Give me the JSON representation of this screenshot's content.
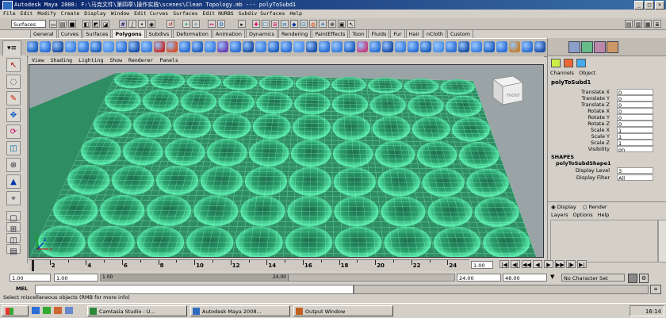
{
  "window": {
    "title": "Autodesk Maya 2008: F:\\马克文件\\第四章\\操作实践\\scenes\\Clean Topology.mb   ---   polyToSubd1"
  },
  "menu": [
    "File",
    "Edit",
    "Modify",
    "Create",
    "Display",
    "Window",
    "Edit Curves",
    "Surfaces",
    "Edit NURBS",
    "Subdiv Surfaces",
    "Help"
  ],
  "status_line": {
    "mode": "Surfaces"
  },
  "shelf_tabs": [
    "General",
    "Curves",
    "Surfaces",
    "Polygons",
    "Subdivs",
    "Deformation",
    "Animation",
    "Dynamics",
    "Rendering",
    "PaintEffects",
    "Toon",
    "Fluids",
    "Fur",
    "Hair",
    "nCloth",
    "Custom"
  ],
  "active_shelf_tab": "Polygons",
  "panel_menu": [
    "View",
    "Shading",
    "Lighting",
    "Show",
    "Renderer",
    "Panels"
  ],
  "viewcube_label": "FRONT",
  "channel_box": {
    "header": [
      "Channels",
      "Object"
    ],
    "object_name": "polyToSubd1",
    "attributes": [
      {
        "label": "Translate X",
        "value": "0"
      },
      {
        "label": "Translate Y",
        "value": "0"
      },
      {
        "label": "Translate Z",
        "value": "0"
      },
      {
        "label": "Rotate X",
        "value": "0"
      },
      {
        "label": "Rotate Y",
        "value": "0"
      },
      {
        "label": "Rotate Z",
        "value": "0"
      },
      {
        "label": "Scale X",
        "value": "1"
      },
      {
        "label": "Scale Y",
        "value": "1"
      },
      {
        "label": "Scale Z",
        "value": "1"
      },
      {
        "label": "Visibility",
        "value": "on"
      }
    ],
    "shapes_label": "SHAPES",
    "shape_name": "polyToSubdShape1",
    "shape_attributes": [
      {
        "label": "Display Level",
        "value": "3"
      },
      {
        "label": "Display Filter",
        "value": "All"
      }
    ]
  },
  "layer_editor": {
    "display_label": "Display",
    "render_label": "Render",
    "menu": [
      "Layers",
      "Options",
      "Help"
    ]
  },
  "timeline": {
    "ticks": [
      "2",
      "4",
      "6",
      "8",
      "10",
      "12",
      "14",
      "16",
      "18",
      "20",
      "22",
      "24"
    ],
    "current_frame": "1.00"
  },
  "range": {
    "start": "1.00",
    "inner_start": "1.00",
    "inner_end": "24.00",
    "end": "48.00",
    "slider_left": "1.00",
    "slider_right": "24.00",
    "character_set": "No Character Set"
  },
  "command_line": {
    "label": "MEL"
  },
  "help_line": "Select miscellaneous objects (RMB for more info)",
  "taskbar": {
    "items": [
      "Camtasia Studio - U...",
      "Autodesk Maya 2008...",
      "Output Window"
    ],
    "clock": "16:14"
  }
}
